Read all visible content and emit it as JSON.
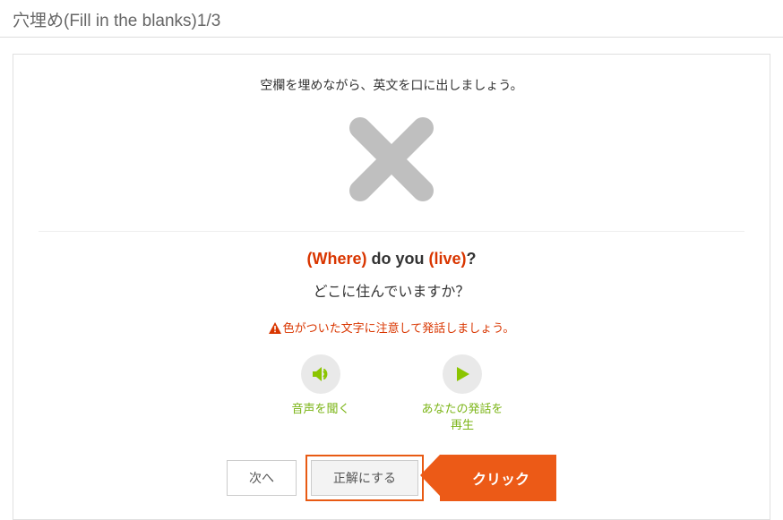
{
  "page_title": "穴埋め(Fill in the blanks)1/3",
  "instruction": "空欄を埋めながら、英文を口に出しましょう。",
  "result": "incorrect",
  "sentence_parts": [
    {
      "text": "(Where) ",
      "style": "red"
    },
    {
      "text": "do ",
      "style": "black"
    },
    {
      "text": "you ",
      "style": "black"
    },
    {
      "text": "(live)",
      "style": "red"
    },
    {
      "text": "?",
      "style": "black"
    }
  ],
  "translation": "どこに住んでいますか？",
  "warning": "色がついた文字に注意して発話しましょう。",
  "media": {
    "listen_label": "音声を聞く",
    "playback_label": "あなたの発話を\n再生"
  },
  "buttons": {
    "next": "次へ",
    "mark_correct": "正解にする"
  },
  "callout": "クリック",
  "colors": {
    "accent": "#ec5a17",
    "green": "#8bc500",
    "gray_x": "#bfbfbf"
  }
}
